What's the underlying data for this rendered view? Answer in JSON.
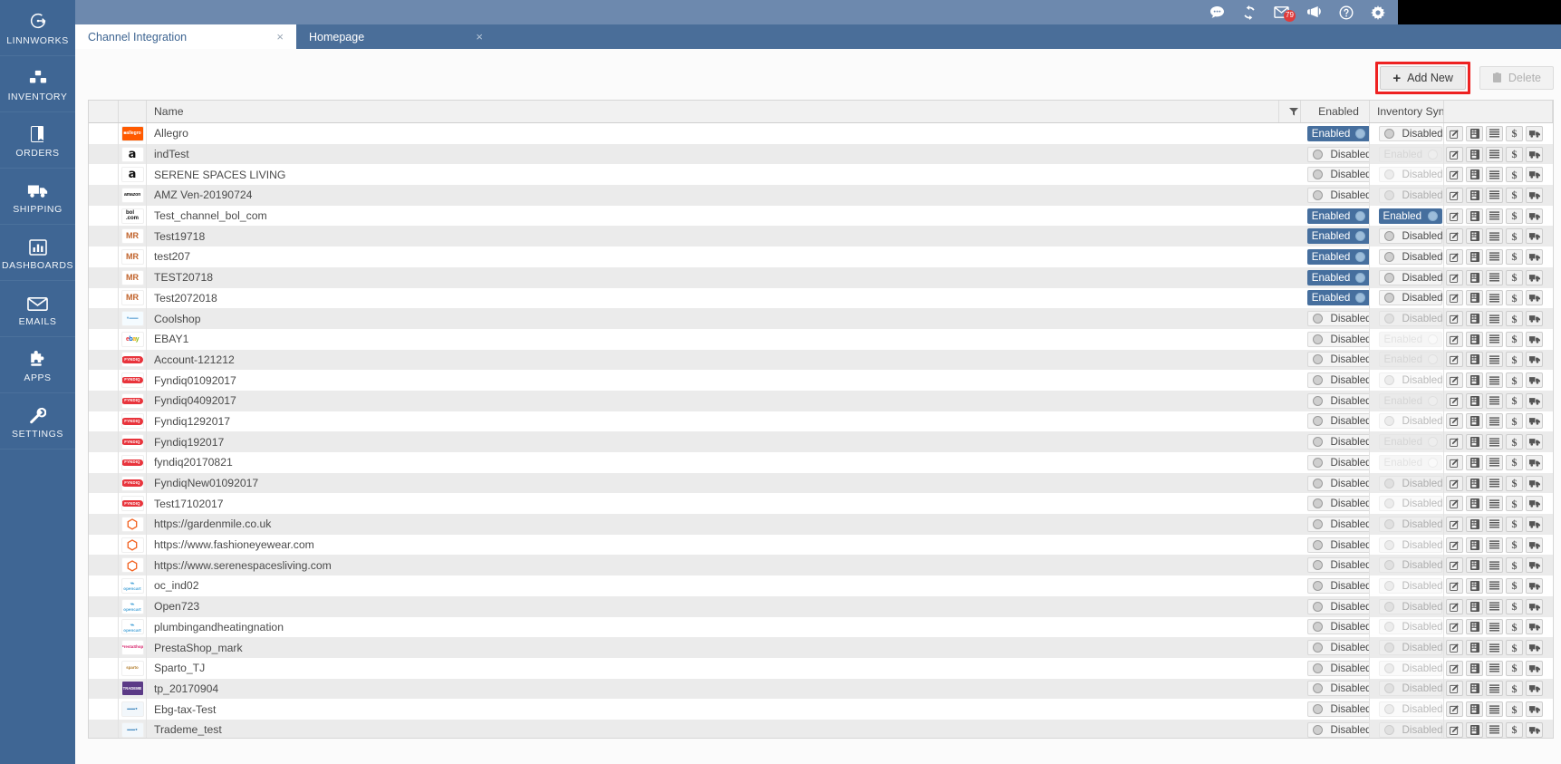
{
  "sidebar": {
    "items": [
      {
        "label": "LINNWORKS",
        "icon": "linnworks-logo-icon"
      },
      {
        "label": "INVENTORY",
        "icon": "boxes-icon"
      },
      {
        "label": "ORDERS",
        "icon": "book-icon"
      },
      {
        "label": "SHIPPING",
        "icon": "truck-icon"
      },
      {
        "label": "DASHBOARDS",
        "icon": "bar-chart-icon"
      },
      {
        "label": "EMAILS",
        "icon": "envelope-icon"
      },
      {
        "label": "APPS",
        "icon": "puzzle-icon"
      },
      {
        "label": "SETTINGS",
        "icon": "wrench-icon"
      }
    ]
  },
  "topbar": {
    "icons": [
      {
        "name": "chat-icon",
        "badge": null
      },
      {
        "name": "refresh-icon",
        "badge": null
      },
      {
        "name": "mail-icon",
        "badge": "79"
      },
      {
        "name": "megaphone-icon",
        "badge": null
      },
      {
        "name": "help-icon",
        "badge": null
      },
      {
        "name": "gear-icon",
        "badge": null
      }
    ]
  },
  "tabs": [
    {
      "label": "Channel Integration",
      "active": true,
      "close": "×"
    },
    {
      "label": "Homepage",
      "active": false,
      "close": "×"
    }
  ],
  "toolbar": {
    "add_new_label": "Add New",
    "add_new_plus": "+",
    "delete_label": "Delete",
    "delete_enabled": false,
    "highlight_color": "#ee2222"
  },
  "grid": {
    "columns": {
      "checkbox": "",
      "logo": "",
      "name": "Name",
      "filter": "filter-icon",
      "enabled": "Enabled",
      "inventory_sync": "Inventory Sync...",
      "actions": ""
    },
    "row_actions": [
      {
        "name": "edit-icon",
        "glyph": "edit"
      },
      {
        "name": "save-icon",
        "glyph": "save"
      },
      {
        "name": "list-icon",
        "glyph": "list"
      },
      {
        "name": "price-icon",
        "glyph": "$"
      },
      {
        "name": "shipping-icon",
        "glyph": "truck"
      }
    ],
    "labels": {
      "enabled": "Enabled",
      "disabled": "Disabled"
    },
    "rows": [
      {
        "name": "Allegro",
        "logo": "allegro",
        "enabled": "Enabled",
        "enabled_state": "on",
        "inv": "Disabled",
        "inv_state": "off"
      },
      {
        "name": "indTest",
        "logo": "amazon",
        "enabled": "Disabled",
        "enabled_state": "off",
        "inv": "Enabled",
        "inv_state": "on-disabled"
      },
      {
        "name": "SERENE SPACES LIVING",
        "logo": "amazon",
        "enabled": "Disabled",
        "enabled_state": "off",
        "inv": "Disabled",
        "inv_state": "off-disabled"
      },
      {
        "name": "AMZ Ven-20190724",
        "logo": "amazonv",
        "enabled": "Disabled",
        "enabled_state": "off",
        "inv": "Disabled",
        "inv_state": "off-disabled"
      },
      {
        "name": "Test_channel_bol_com",
        "logo": "bol",
        "enabled": "Enabled",
        "enabled_state": "on",
        "inv": "Enabled",
        "inv_state": "on"
      },
      {
        "name": "Test19718",
        "logo": "mr",
        "enabled": "Enabled",
        "enabled_state": "on",
        "inv": "Disabled",
        "inv_state": "off"
      },
      {
        "name": "test207",
        "logo": "mr",
        "enabled": "Enabled",
        "enabled_state": "on",
        "inv": "Disabled",
        "inv_state": "off"
      },
      {
        "name": "TEST20718",
        "logo": "mr",
        "enabled": "Enabled",
        "enabled_state": "on",
        "inv": "Disabled",
        "inv_state": "off"
      },
      {
        "name": "Test2072018",
        "logo": "mr",
        "enabled": "Enabled",
        "enabled_state": "on",
        "inv": "Disabled",
        "inv_state": "off"
      },
      {
        "name": "Coolshop",
        "logo": "cool",
        "enabled": "Disabled",
        "enabled_state": "off",
        "inv": "Disabled",
        "inv_state": "off-disabled"
      },
      {
        "name": "EBAY1",
        "logo": "ebay",
        "enabled": "Disabled",
        "enabled_state": "off",
        "inv": "Enabled",
        "inv_state": "on-disabled"
      },
      {
        "name": "Account-121212",
        "logo": "fyndiq",
        "enabled": "Disabled",
        "enabled_state": "off",
        "inv": "Enabled",
        "inv_state": "on-disabled"
      },
      {
        "name": "Fyndiq01092017",
        "logo": "fyndiq",
        "enabled": "Disabled",
        "enabled_state": "off",
        "inv": "Disabled",
        "inv_state": "off-disabled"
      },
      {
        "name": "Fyndiq04092017",
        "logo": "fyndiq",
        "enabled": "Disabled",
        "enabled_state": "off",
        "inv": "Enabled",
        "inv_state": "on-disabled"
      },
      {
        "name": "Fyndiq1292017",
        "logo": "fyndiq",
        "enabled": "Disabled",
        "enabled_state": "off",
        "inv": "Disabled",
        "inv_state": "off-disabled"
      },
      {
        "name": "Fyndiq192017",
        "logo": "fyndiq",
        "enabled": "Disabled",
        "enabled_state": "off",
        "inv": "Enabled",
        "inv_state": "on-disabled"
      },
      {
        "name": "fyndiq20170821",
        "logo": "fyndiq",
        "enabled": "Disabled",
        "enabled_state": "off",
        "inv": "Enabled",
        "inv_state": "on-disabled"
      },
      {
        "name": "FyndiqNew01092017",
        "logo": "fyndiq",
        "enabled": "Disabled",
        "enabled_state": "off",
        "inv": "Disabled",
        "inv_state": "off-disabled"
      },
      {
        "name": "Test17102017",
        "logo": "fyndiq",
        "enabled": "Disabled",
        "enabled_state": "off",
        "inv": "Disabled",
        "inv_state": "off-disabled"
      },
      {
        "name": "https://gardenmile.co.uk",
        "logo": "magento",
        "enabled": "Disabled",
        "enabled_state": "off",
        "inv": "Disabled",
        "inv_state": "off-disabled"
      },
      {
        "name": "https://www.fashioneyewear.com",
        "logo": "magento",
        "enabled": "Disabled",
        "enabled_state": "off",
        "inv": "Disabled",
        "inv_state": "off-disabled"
      },
      {
        "name": "https://www.serenespacesliving.com",
        "logo": "magento",
        "enabled": "Disabled",
        "enabled_state": "off",
        "inv": "Disabled",
        "inv_state": "off-disabled"
      },
      {
        "name": "oc_ind02",
        "logo": "oc",
        "enabled": "Disabled",
        "enabled_state": "off",
        "inv": "Disabled",
        "inv_state": "off-disabled"
      },
      {
        "name": "Open723",
        "logo": "oc",
        "enabled": "Disabled",
        "enabled_state": "off",
        "inv": "Disabled",
        "inv_state": "off-disabled"
      },
      {
        "name": "plumbingandheatingnation",
        "logo": "oc",
        "enabled": "Disabled",
        "enabled_state": "off",
        "inv": "Disabled",
        "inv_state": "off-disabled"
      },
      {
        "name": "PrestaShop_mark",
        "logo": "presta",
        "enabled": "Disabled",
        "enabled_state": "off",
        "inv": "Disabled",
        "inv_state": "off-disabled"
      },
      {
        "name": "Sparto_TJ",
        "logo": "sparto",
        "enabled": "Disabled",
        "enabled_state": "off",
        "inv": "Disabled",
        "inv_state": "off-disabled"
      },
      {
        "name": "tp_20170904",
        "logo": "tp",
        "enabled": "Disabled",
        "enabled_state": "off",
        "inv": "Disabled",
        "inv_state": "off-disabled"
      },
      {
        "name": "Ebg-tax-Test",
        "logo": "td",
        "enabled": "Disabled",
        "enabled_state": "off",
        "inv": "Disabled",
        "inv_state": "off-disabled"
      },
      {
        "name": "Trademe_test",
        "logo": "td",
        "enabled": "Disabled",
        "enabled_state": "off",
        "inv": "Disabled",
        "inv_state": "off-disabled"
      }
    ]
  },
  "colors": {
    "sidebar": "#3f6694",
    "topbar": "#6d89ae",
    "tabstrip": "#4a6e99",
    "toggle_on": "#466f9e",
    "badge": "#e03b3b"
  }
}
